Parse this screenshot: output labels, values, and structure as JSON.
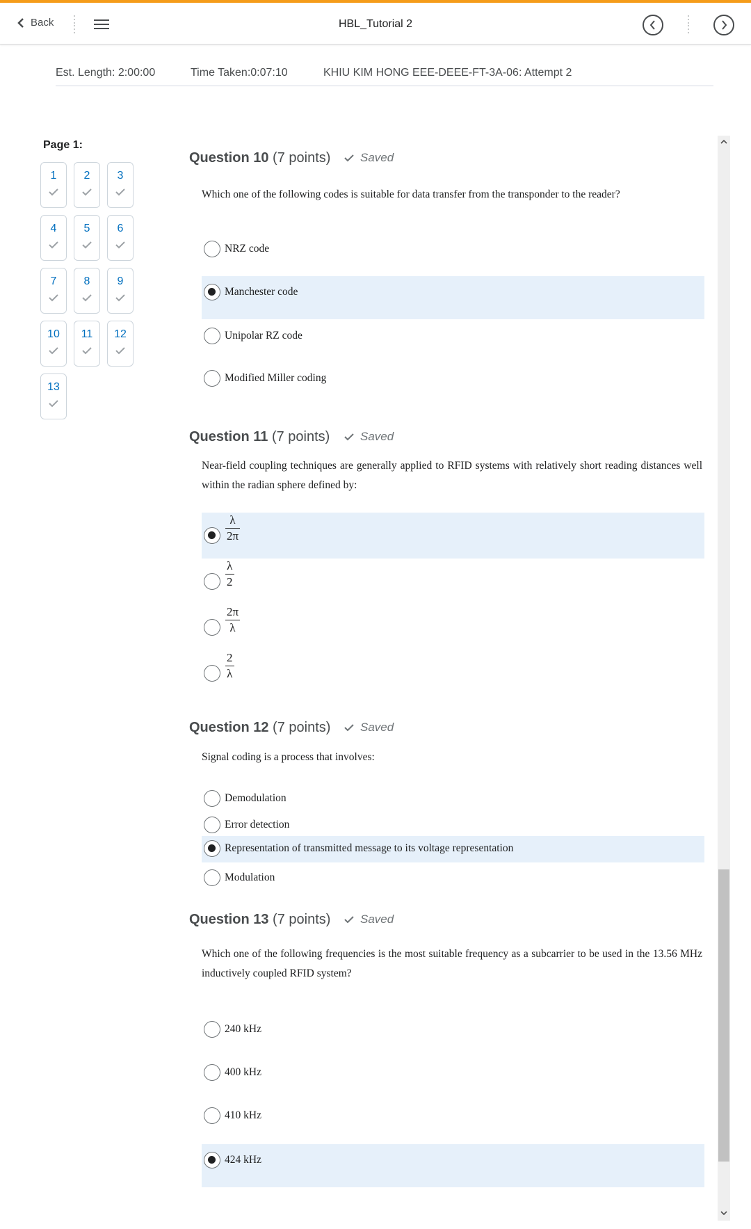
{
  "header": {
    "back_label": "Back",
    "title": "HBL_Tutorial 2",
    "accent_color": "#f59c1a",
    "icons": [
      "chevron-left-icon",
      "vertical-dots-icon",
      "hamburger-menu-icon",
      "circle-arrow-left-icon",
      "circle-arrow-right-icon"
    ]
  },
  "info": {
    "est_length": "Est. Length: 2:00:00",
    "time_taken": "Time Taken:0:07:10",
    "attempt": "KHIU KIM HONG EEE-DEEE-FT-3A-06: Attempt 2"
  },
  "nav": {
    "page_label": "Page 1:",
    "questions": [
      {
        "num": "1",
        "saved": true
      },
      {
        "num": "2",
        "saved": true
      },
      {
        "num": "3",
        "saved": true
      },
      {
        "num": "4",
        "saved": true
      },
      {
        "num": "5",
        "saved": true
      },
      {
        "num": "6",
        "saved": true
      },
      {
        "num": "7",
        "saved": true
      },
      {
        "num": "8",
        "saved": true
      },
      {
        "num": "9",
        "saved": true
      },
      {
        "num": "10",
        "saved": true
      },
      {
        "num": "11",
        "saved": true
      },
      {
        "num": "12",
        "saved": true
      },
      {
        "num": "13",
        "saved": true
      }
    ]
  },
  "questions": [
    {
      "title": "Question 10",
      "points": "(7 points)",
      "status": "Saved",
      "text": "Which one of the following codes is suitable for data transfer from the transponder to the reader?",
      "selected": 1,
      "options": [
        "NRZ code",
        "Manchester code",
        "Unipolar RZ code",
        "Modified Miller coding"
      ]
    },
    {
      "title": "Question 11",
      "points": "(7 points)",
      "status": "Saved",
      "text": "Near-field coupling techniques are generally applied to RFID systems with relatively short reading distances well within the radian sphere defined by:",
      "selected": 0,
      "options": [
        {
          "num": "λ",
          "den": "2π"
        },
        {
          "num": "λ",
          "den": "2"
        },
        {
          "num": "2π",
          "den": "λ"
        },
        {
          "num": "2",
          "den": "λ"
        }
      ]
    },
    {
      "title": "Question 12",
      "points": "(7 points)",
      "status": "Saved",
      "text": "Signal coding is a process that involves:",
      "selected": 2,
      "options": [
        "Demodulation",
        "Error detection",
        "Representation of transmitted message to its voltage representation",
        "Modulation"
      ]
    },
    {
      "title": "Question 13",
      "points": "(7 points)",
      "status": "Saved",
      "text": "Which one of the following frequencies is the most suitable frequency as a subcarrier to be used in the 13.56 MHz inductively coupled RFID system?",
      "selected": 3,
      "options": [
        "240 kHz",
        "400 kHz",
        "410 kHz",
        "424 kHz"
      ]
    }
  ]
}
